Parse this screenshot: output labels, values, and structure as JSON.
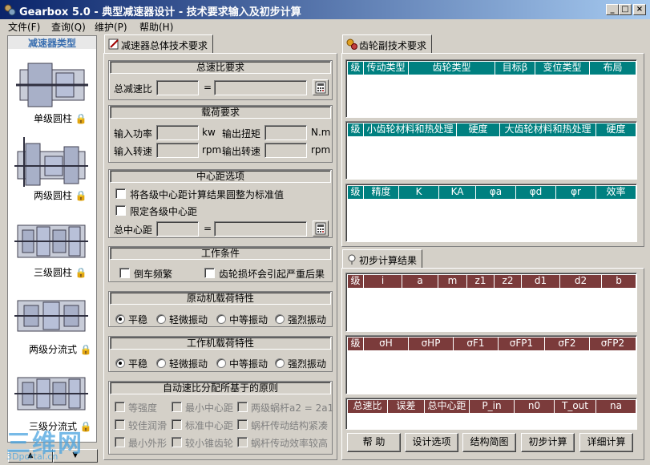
{
  "window": {
    "title": "Gearbox 5.0 - 典型减速器设计 - 技术要求输入及初步计算",
    "buttons": [
      "_",
      "□",
      "×"
    ]
  },
  "menu": [
    {
      "label": "文件(F)"
    },
    {
      "label": "查询(Q)"
    },
    {
      "label": "维护(P)"
    },
    {
      "label": "帮助(H)"
    }
  ],
  "sidebar": {
    "title": "减速器类型",
    "items": [
      {
        "label": "单级圆柱"
      },
      {
        "label": "两级圆柱"
      },
      {
        "label": "三级圆柱"
      },
      {
        "label": "两级分流式"
      },
      {
        "label": "三级分流式"
      }
    ],
    "nav_up": "▲",
    "nav_down": "▼"
  },
  "tabs": {
    "overall": "减速器总体技术要求",
    "gear": "齿轮副技术要求",
    "prelim": "初步计算结果"
  },
  "ratio": {
    "title": "总速比要求",
    "total_label": "总减速比",
    "equals": "="
  },
  "load": {
    "title": "载荷要求",
    "power_label": "输入功率",
    "power_unit": "kw",
    "torque_label": "输出扭矩",
    "torque_unit": "N.m",
    "in_speed_label": "输入转速",
    "in_speed_unit": "rpm",
    "out_speed_label": "输出转速",
    "out_speed_unit": "rpm"
  },
  "center": {
    "title": "中心距选项",
    "opt1": "将各级中心距计算结果圆整为标准值",
    "opt2": "限定各级中心距",
    "total_label": "总中心距",
    "equals": "="
  },
  "work": {
    "title": "工作条件",
    "opt1": "倒车频繁",
    "opt2": "齿轮损坏会引起严重后果"
  },
  "prime": {
    "title": "原动机载荷特性",
    "options": [
      "平稳",
      "轻微振动",
      "中等振动",
      "强烈振动"
    ],
    "selected": "平稳"
  },
  "machine": {
    "title": "工作机载荷特性",
    "options": [
      "平稳",
      "轻微振动",
      "中等振动",
      "强烈振动"
    ],
    "selected": "平稳"
  },
  "principle": {
    "title": "自动速比分配所基于的原则",
    "options": [
      "等强度",
      "最小中心距",
      "两级蜗杆a2 = 2a1",
      "较佳润滑",
      "标准中心距",
      "蜗杆传动结构紧凑",
      "最小外形",
      "较小锥齿轮",
      "蜗杆传动效率较高"
    ]
  },
  "gear_tables": {
    "t1": [
      "级",
      "传动类型",
      "齿轮类型",
      "目标β",
      "变位类型",
      "布局"
    ],
    "t2": [
      "级",
      "小齿轮材料和热处理",
      "硬度",
      "大齿轮材料和热处理",
      "硬度"
    ],
    "t3": [
      "级",
      "精度",
      "K",
      "KA",
      "φa",
      "φd",
      "φr",
      "效率"
    ]
  },
  "result_tables": {
    "r1": [
      "级",
      "i",
      "a",
      "m",
      "z1",
      "z2",
      "d1",
      "d2",
      "b"
    ],
    "r2": [
      "级",
      "σH",
      "σHP",
      "σF1",
      "σFP1",
      "σF2",
      "σFP2"
    ],
    "r3": [
      "总速比",
      "误差",
      "总中心距",
      "P_in",
      "n0",
      "T_out",
      "na"
    ]
  },
  "buttons": {
    "help": "帮 助",
    "design": "设计选项",
    "sketch": "结构简图",
    "prelim": "初步计算",
    "detail": "详细计算"
  },
  "watermark": {
    "text": "三维网",
    "sub": "3Dportal.cn"
  },
  "colors": {
    "title_start": "#0a246a",
    "title_end": "#a6caf0",
    "teal_header": "#008080",
    "maroon_header": "#7b3b3b",
    "face": "#d4d0c8"
  }
}
